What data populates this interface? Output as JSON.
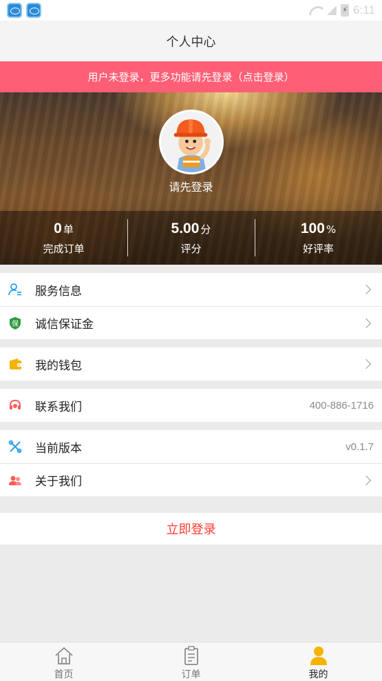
{
  "status_bar": {
    "time": "6:11",
    "app_icons": [
      "app-notification-icon",
      "app-notification-icon"
    ]
  },
  "header": {
    "title": "个人中心"
  },
  "banner": {
    "text": "用户未登录，更多功能请先登录（点击登录）"
  },
  "profile": {
    "avatar": "worker-avatar",
    "prompt": "请先登录",
    "stats": [
      {
        "value": "0",
        "unit": "单",
        "label": "完成订单"
      },
      {
        "value": "5.00",
        "unit": "分",
        "label": "评分"
      },
      {
        "value": "100",
        "unit": "%",
        "label": "好评率"
      }
    ]
  },
  "menu": {
    "service_info": {
      "label": "服务信息",
      "icon": "user-list-icon",
      "color": "#2aa1e8"
    },
    "deposit": {
      "label": "诚信保证金",
      "icon": "shield-bao-icon",
      "icon_text": "保",
      "color": "#2e9a3e"
    },
    "wallet": {
      "label": "我的钱包",
      "icon": "wallet-icon",
      "color": "#f5b400"
    },
    "contact": {
      "label": "联系我们",
      "icon": "headset-icon",
      "value": "400-886-1716",
      "color": "#ff5a5a"
    },
    "version": {
      "label": "当前版本",
      "icon": "tools-icon",
      "value": "v0.1.7",
      "color": "#2aa1e8"
    },
    "about": {
      "label": "关于我们",
      "icon": "people-icon",
      "color": "#ff5a5a"
    }
  },
  "login_button": {
    "label": "立即登录",
    "color": "#ff3b2f"
  },
  "tab_bar": {
    "tabs": [
      {
        "label": "首页",
        "icon": "home-icon"
      },
      {
        "label": "订单",
        "icon": "clipboard-icon"
      },
      {
        "label": "我的",
        "icon": "person-icon",
        "active": true,
        "color": "#f5b400"
      }
    ]
  },
  "colors": {
    "banner": "#ff5f76",
    "accent_yellow": "#f5b400",
    "accent_blue": "#2aa1e8"
  }
}
